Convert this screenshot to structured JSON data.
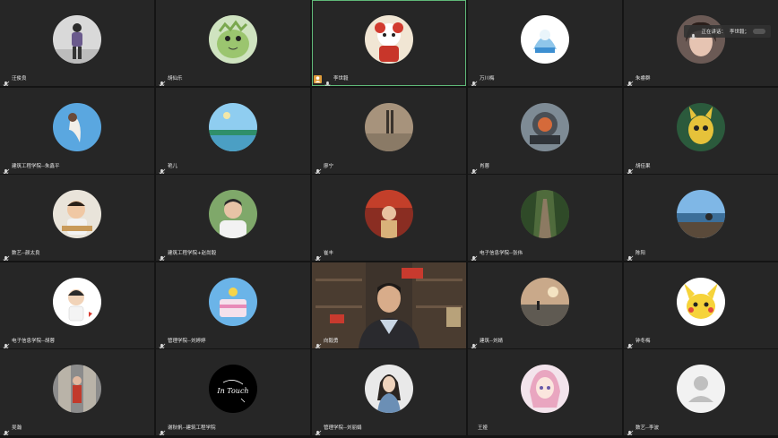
{
  "speaking_label": "正在讲话：",
  "speaking_name": "李世毅；",
  "participants": [
    {
      "name": "汪俊良"
    },
    {
      "name": "胡仙乐"
    },
    {
      "name": "李世毅"
    },
    {
      "name": "万川梅"
    },
    {
      "name": "朱睿群"
    },
    {
      "name": "建筑工程学院--朱鑫平"
    },
    {
      "name": "艳儿"
    },
    {
      "name": "廖宁"
    },
    {
      "name": "肖蓉"
    },
    {
      "name": "胡佳果"
    },
    {
      "name": "数艺--颜太良"
    },
    {
      "name": "建筑工程学院+赵尚毅"
    },
    {
      "name": "崔丰"
    },
    {
      "name": "电子信息学院--张伟"
    },
    {
      "name": "陈阳"
    },
    {
      "name": "电子信息学院--胡蓉"
    },
    {
      "name": "管理学院--刘婷婷"
    },
    {
      "name": "向毅勇"
    },
    {
      "name": "建筑--刘婧"
    },
    {
      "name": "钟冬梅"
    },
    {
      "name": "吴瀚"
    },
    {
      "name": "谢秋帆--建筑工程学院"
    },
    {
      "name": "管理学院--刘丽娟"
    },
    {
      "name": "王娅"
    },
    {
      "name": "数艺--李波"
    }
  ],
  "avatar_text": "In Touch",
  "colors": {
    "active_border": "#5fb878",
    "tile_bg": "#262626",
    "host_badge": "#e09c3a"
  }
}
